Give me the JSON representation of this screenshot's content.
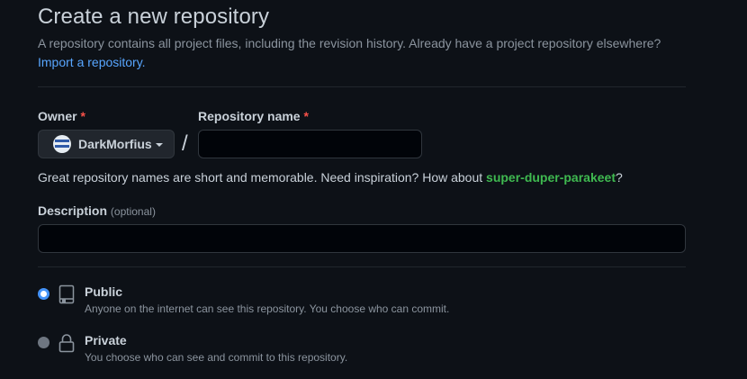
{
  "header": {
    "title": "Create a new repository",
    "subtitle": "A repository contains all project files, including the revision history. Already have a project repository elsewhere?",
    "import_link": "Import a repository."
  },
  "owner": {
    "label": "Owner",
    "required_mark": "*",
    "selected": "DarkMorfius",
    "icon": "chevron-down-icon"
  },
  "separator": "/",
  "repository_name": {
    "label": "Repository name",
    "required_mark": "*",
    "value": ""
  },
  "name_hint": {
    "text": "Great repository names are short and memorable. Need inspiration? How about ",
    "suggestion": "super-duper-parakeet",
    "suffix": "?"
  },
  "description": {
    "label": "Description",
    "optional": "(optional)",
    "value": ""
  },
  "visibility": {
    "options": [
      {
        "title": "Public",
        "description": "Anyone on the internet can see this repository. You choose who can commit.",
        "icon": "repo-icon",
        "checked": true
      },
      {
        "title": "Private",
        "description": "You choose who can see and commit to this repository.",
        "icon": "lock-icon",
        "checked": false
      }
    ]
  },
  "colors": {
    "background": "#0d1117",
    "link": "#58a6ff",
    "suggestion": "#3fb950",
    "required": "#f85149",
    "radio_selected": "#4493f8"
  }
}
